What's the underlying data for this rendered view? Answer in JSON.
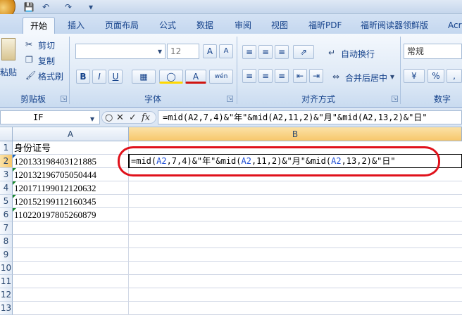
{
  "quick_access": {
    "save_icon": "save-icon",
    "undo_icon": "undo-icon",
    "redo_icon": "redo-icon"
  },
  "tabs": [
    {
      "label": "开始",
      "active": true
    },
    {
      "label": "插入"
    },
    {
      "label": "页面布局"
    },
    {
      "label": "公式"
    },
    {
      "label": "数据"
    },
    {
      "label": "审阅"
    },
    {
      "label": "视图"
    },
    {
      "label": "福昕PDF"
    },
    {
      "label": "福昕阅读器领鲜版"
    },
    {
      "label": "Acr"
    }
  ],
  "ribbon": {
    "clipboard": {
      "paste": "粘贴",
      "cut": "剪切",
      "copy": "复制",
      "format_painter": "格式刷",
      "label": "剪贴板"
    },
    "font": {
      "size": "12",
      "label": "字体",
      "bold": "B",
      "italic": "I",
      "underline": "U"
    },
    "alignment": {
      "wrap": "自动换行",
      "merge": "合并后居中",
      "label": "对齐方式"
    },
    "number": {
      "format": "常规",
      "percent": "%",
      "label": "数字"
    }
  },
  "formula_bar": {
    "name_box": "IF",
    "formula_parts": [
      "=mid(A2,7,4)&\"年\"&mid(A2,11,2)&\"月\"&mid(A2,13,2)&\"日\""
    ]
  },
  "grid": {
    "columns": [
      "A",
      "B"
    ],
    "rows": [
      "1",
      "2",
      "3",
      "4",
      "5",
      "6",
      "7",
      "8",
      "9",
      "10",
      "11",
      "12",
      "13"
    ],
    "cells_a": [
      "身份证号",
      "120133198403121885",
      "120132196705050444",
      "120171199012120632",
      "120152199112160345",
      "110220197805260879"
    ],
    "edit_parts": [
      "=mid(",
      "A2",
      ",7,4)&\"年\"&mid(",
      "A2",
      ",11,2)&\"月\"&mid(",
      "A2",
      ",13,2)&\"日\""
    ]
  },
  "colors": {
    "highlight_oval": "#e0111b",
    "ref_blue": "#1f4fd6"
  }
}
